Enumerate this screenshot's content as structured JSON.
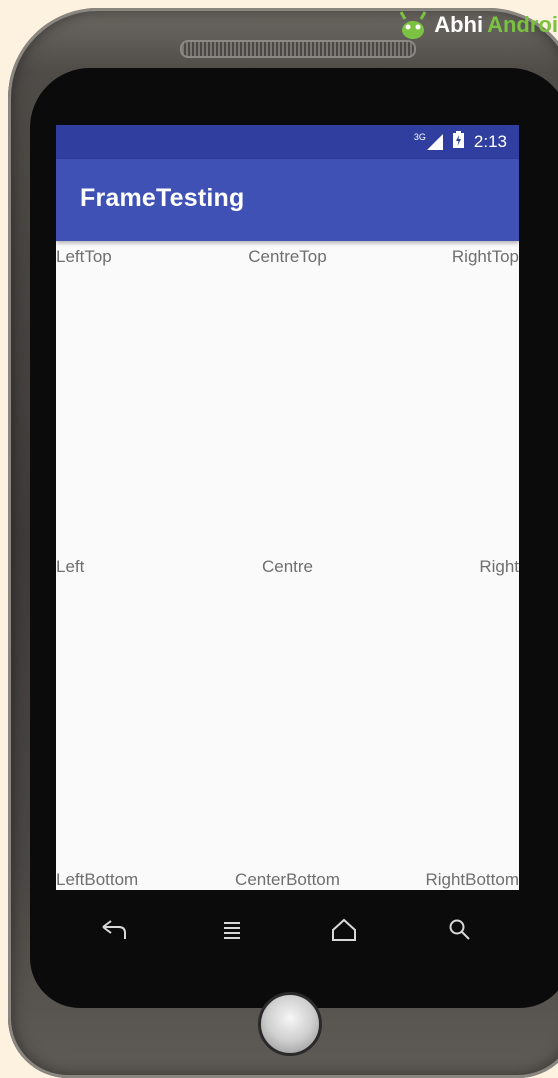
{
  "logo": {
    "text_part1": "Abhi",
    "text_part2": "Androi"
  },
  "status_bar": {
    "network": "3G",
    "time": "2:13"
  },
  "app_bar": {
    "title": "FrameTesting"
  },
  "frame_labels": {
    "left_top": "LeftTop",
    "centre_top": "CentreTop",
    "right_top": "RightTop",
    "left": "Left",
    "centre": "Centre",
    "right": "Right",
    "left_bottom": "LeftBottom",
    "center_bottom": "CenterBottom",
    "right_bottom": "RightBottom"
  },
  "nav_buttons": [
    "back-icon",
    "menu-icon",
    "home-icon",
    "search-icon"
  ],
  "colors": {
    "status_bar": "#303f9f",
    "app_bar": "#3f51b5",
    "screen_bg": "#fafafa",
    "label_text": "#6f6f6f",
    "logo_green": "#7cc242"
  }
}
